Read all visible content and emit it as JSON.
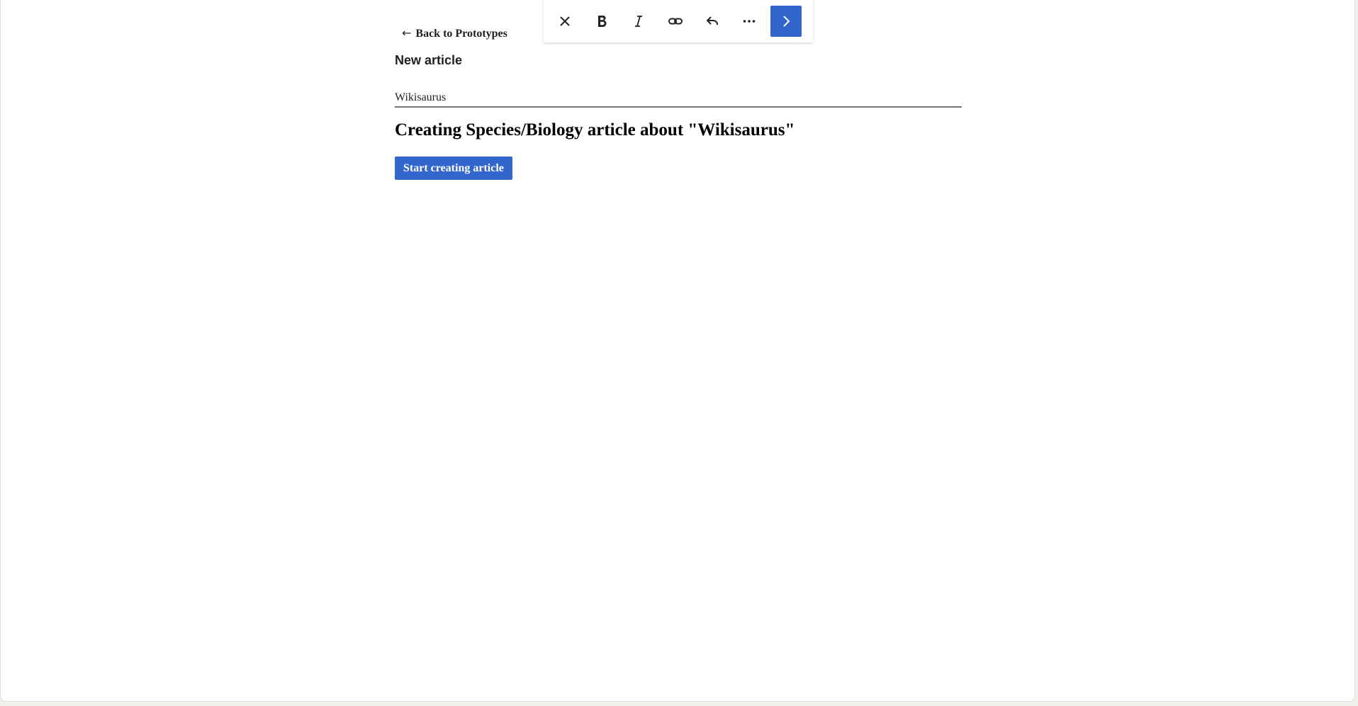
{
  "back_link": {
    "arrow": "←",
    "label": "Back to Prototypes"
  },
  "page_title": "New article",
  "title_input": {
    "value": "Wikisaurus"
  },
  "heading": "Creating Species/Biology article about \"Wikisaurus\"",
  "start_button": "Start creating article",
  "toolbar": {
    "buttons": [
      {
        "name": "close",
        "icon": "close-icon"
      },
      {
        "name": "bold",
        "icon": "bold-icon"
      },
      {
        "name": "italic",
        "icon": "italic-icon"
      },
      {
        "name": "link",
        "icon": "link-icon"
      },
      {
        "name": "undo",
        "icon": "undo-icon"
      },
      {
        "name": "more",
        "icon": "ellipsis-icon"
      },
      {
        "name": "next",
        "icon": "chevron-right-icon"
      }
    ]
  },
  "colors": {
    "accent": "#3366cc",
    "text": "#202122",
    "background": "#ffffff",
    "outer_background": "#eef0eb"
  }
}
